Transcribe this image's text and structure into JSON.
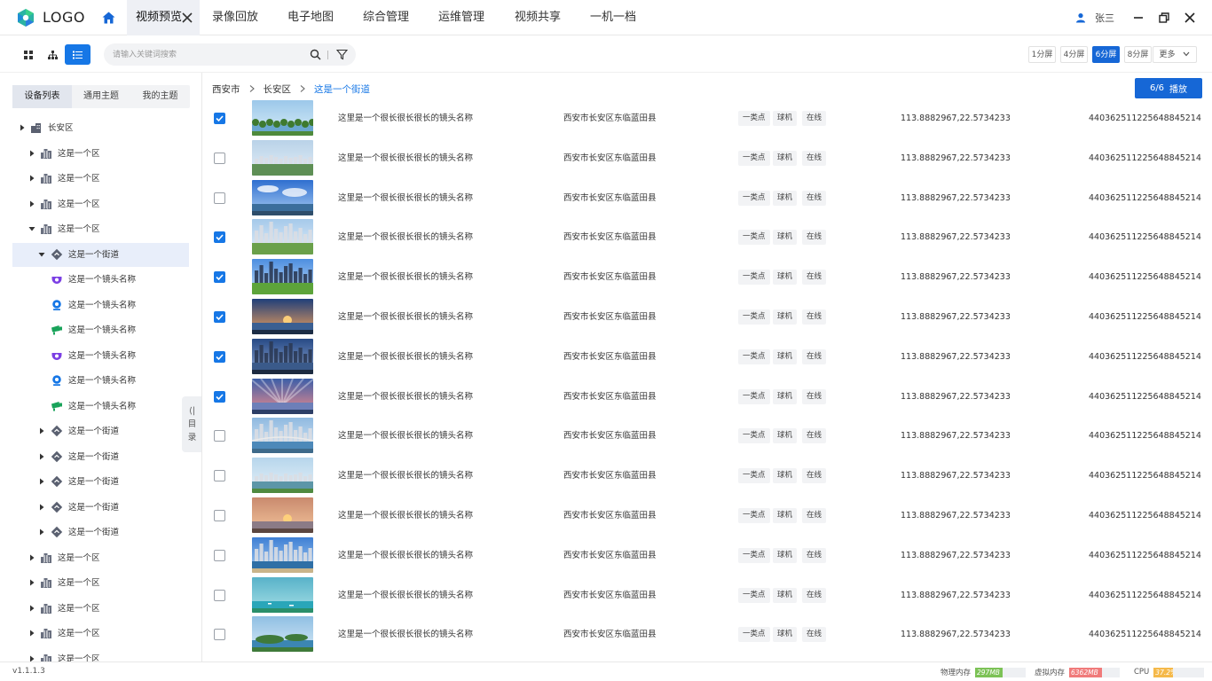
{
  "app": {
    "logo_text": "LOGO"
  },
  "nav": {
    "active_tab": "视频预览",
    "items": [
      "录像回放",
      "电子地图",
      "综合管理",
      "运维管理",
      "视频共享",
      "一机一档"
    ]
  },
  "user": {
    "name": "张三"
  },
  "search": {
    "placeholder": "请输入关键词搜索"
  },
  "split_buttons": [
    {
      "label": "1分屏",
      "active": false
    },
    {
      "label": "4分屏",
      "active": false
    },
    {
      "label": "6分屏",
      "active": true
    },
    {
      "label": "8分屏",
      "active": false
    }
  ],
  "more_label": "更多",
  "sidebar": {
    "tabs": [
      {
        "label": "设备列表",
        "active": true
      },
      {
        "label": "通用主题",
        "active": false
      },
      {
        "label": "我的主题",
        "active": false
      }
    ],
    "collapse_text": [
      "目",
      "录"
    ],
    "tree": [
      {
        "label": "长安区",
        "level": 0,
        "icon": "building-icon",
        "arrow": "right"
      },
      {
        "label": "这是一个区",
        "level": 1,
        "icon": "city-icon",
        "arrow": "right"
      },
      {
        "label": "这是一个区",
        "level": 1,
        "icon": "city-icon",
        "arrow": "right"
      },
      {
        "label": "这是一个区",
        "level": 1,
        "icon": "city-icon",
        "arrow": "right"
      },
      {
        "label": "这是一个区",
        "level": 1,
        "icon": "city-icon",
        "arrow": "down"
      },
      {
        "label": "这是一个街道",
        "level": 2,
        "icon": "street-icon",
        "arrow": "down",
        "selected": true
      },
      {
        "label": "这是一个镜头名称",
        "level": 3,
        "icon": "dome-camera-icon",
        "arrow": "none"
      },
      {
        "label": "这是一个镜头名称",
        "level": 3,
        "icon": "webcam-icon",
        "arrow": "none"
      },
      {
        "label": "这是一个镜头名称",
        "level": 3,
        "icon": "bullet-camera-icon",
        "arrow": "none"
      },
      {
        "label": "这是一个镜头名称",
        "level": 3,
        "icon": "dome-camera-icon",
        "arrow": "none"
      },
      {
        "label": "这是一个镜头名称",
        "level": 3,
        "icon": "webcam-icon",
        "arrow": "none"
      },
      {
        "label": "这是一个镜头名称",
        "level": 3,
        "icon": "bullet-camera-icon",
        "arrow": "none"
      },
      {
        "label": "这是一个街道",
        "level": 2,
        "icon": "street-icon",
        "arrow": "right"
      },
      {
        "label": "这是一个街道",
        "level": 2,
        "icon": "street-icon",
        "arrow": "right"
      },
      {
        "label": "这是一个街道",
        "level": 2,
        "icon": "street-icon",
        "arrow": "right"
      },
      {
        "label": "这是一个街道",
        "level": 2,
        "icon": "street-icon",
        "arrow": "right"
      },
      {
        "label": "这是一个街道",
        "level": 2,
        "icon": "street-icon",
        "arrow": "right"
      },
      {
        "label": "这是一个区",
        "level": 1,
        "icon": "city-icon",
        "arrow": "right"
      },
      {
        "label": "这是一个区",
        "level": 1,
        "icon": "city-icon",
        "arrow": "right"
      },
      {
        "label": "这是一个区",
        "level": 1,
        "icon": "city-icon",
        "arrow": "right"
      },
      {
        "label": "这是一个区",
        "level": 1,
        "icon": "city-icon",
        "arrow": "right"
      },
      {
        "label": "这是一个区",
        "level": 1,
        "icon": "city-icon",
        "arrow": "right"
      }
    ]
  },
  "breadcrumb": [
    "西安市",
    "长安区",
    "这是一个街道"
  ],
  "play_button": {
    "count": "6/6",
    "label": "播放"
  },
  "rows": [
    {
      "checked": true,
      "scene": "lake-trees",
      "name": "这里是一个很长很长很长的镜头名称",
      "address": "西安市长安区东临蓝田县",
      "tags": [
        "一类点",
        "球机",
        "在线"
      ],
      "coords": "113.8882967,22.5734233",
      "code": "440362511225648845214"
    },
    {
      "checked": false,
      "scene": "city-aerial",
      "name": "这里是一个很长很长很长的镜头名称",
      "address": "西安市长安区东临蓝田县",
      "tags": [
        "一类点",
        "球机",
        "在线"
      ],
      "coords": "113.8882967,22.5734233",
      "code": "440362511225648845214"
    },
    {
      "checked": false,
      "scene": "blue-sky-city",
      "name": "这里是一个很长很长很长的镜头名称",
      "address": "西安市长安区东临蓝田县",
      "tags": [
        "一类点",
        "球机",
        "在线"
      ],
      "coords": "113.8882967,22.5734233",
      "code": "440362511225648845214"
    },
    {
      "checked": true,
      "scene": "green-city",
      "name": "这里是一个很长很长很长的镜头名称",
      "address": "西安市长安区东临蓝田县",
      "tags": [
        "一类点",
        "球机",
        "在线"
      ],
      "coords": "113.8882967,22.5734233",
      "code": "440362511225648845214"
    },
    {
      "checked": true,
      "scene": "park-skyline",
      "name": "这里是一个很长很长很长的镜头名称",
      "address": "西安市长安区东临蓝田县",
      "tags": [
        "一类点",
        "球机",
        "在线"
      ],
      "coords": "113.8882967,22.5734233",
      "code": "440362511225648845214"
    },
    {
      "checked": true,
      "scene": "sunset-pier",
      "name": "这里是一个很长很长很长的镜头名称",
      "address": "西安市长安区东临蓝田县",
      "tags": [
        "一类点",
        "球机",
        "在线"
      ],
      "coords": "113.8882967,22.5734233",
      "code": "440362511225648845214"
    },
    {
      "checked": true,
      "scene": "dusk-skyline",
      "name": "这里是一个很长很长很长的镜头名称",
      "address": "西安市长安区东临蓝田县",
      "tags": [
        "一类点",
        "球机",
        "在线"
      ],
      "coords": "113.8882967,22.5734233",
      "code": "440362511225648845214"
    },
    {
      "checked": true,
      "scene": "pink-sunset",
      "name": "这里是一个很长很长很长的镜头名称",
      "address": "西安市长安区东临蓝田县",
      "tags": [
        "一类点",
        "球机",
        "在线"
      ],
      "coords": "113.8882967,22.5734233",
      "code": "440362511225648845214"
    },
    {
      "checked": false,
      "scene": "bay-bridge",
      "name": "这里是一个很长很长很长的镜头名称",
      "address": "西安市长安区东临蓝田县",
      "tags": [
        "一类点",
        "球机",
        "在线"
      ],
      "coords": "113.8882967,22.5734233",
      "code": "440362511225648845214"
    },
    {
      "checked": false,
      "scene": "aerial-green",
      "name": "这里是一个很长很长很长的镜头名称",
      "address": "西安市长安区东临蓝田县",
      "tags": [
        "一类点",
        "球机",
        "在线"
      ],
      "coords": "113.8882967,22.5734233",
      "code": "440362511225648845214"
    },
    {
      "checked": false,
      "scene": "sunset-sea",
      "name": "这里是一个很长很长很长的镜头名称",
      "address": "西安市长安区东临蓝田县",
      "tags": [
        "一类点",
        "球机",
        "在线"
      ],
      "coords": "113.8882967,22.5734233",
      "code": "440362511225648845214"
    },
    {
      "checked": false,
      "scene": "coastal-town",
      "name": "这里是一个很长很长很长的镜头名称",
      "address": "西安市长安区东临蓝田县",
      "tags": [
        "一类点",
        "球机",
        "在线"
      ],
      "coords": "113.8882967,22.5734233",
      "code": "440362511225648845214"
    },
    {
      "checked": false,
      "scene": "turquoise-sea",
      "name": "这里是一个很长很长很长的镜头名称",
      "address": "西安市长安区东临蓝田县",
      "tags": [
        "一类点",
        "球机",
        "在线"
      ],
      "coords": "113.8882967,22.5734233",
      "code": "440362511225648845214"
    },
    {
      "checked": false,
      "scene": "green-islands",
      "name": "这里是一个很长很长很长的镜头名称",
      "address": "西安市长安区东临蓝田县",
      "tags": [
        "一类点",
        "球机",
        "在线"
      ],
      "coords": "113.8882967,22.5734233",
      "code": "440362511225648845214"
    }
  ],
  "status": {
    "version": "v1.1.1.3",
    "meters": [
      {
        "label": "物理内存",
        "value": "297MB",
        "fraction": 0.55,
        "color": "#7cc256"
      },
      {
        "label": "虚拟内存",
        "value": "6362MB",
        "fraction": 0.65,
        "color": "#f07a7a"
      },
      {
        "label": "CPU",
        "value": "37.2%",
        "fraction": 0.372,
        "color": "#f5b94a"
      }
    ]
  },
  "colors": {
    "accent": "#1677e6",
    "selected_bg": "#e8eefa"
  }
}
